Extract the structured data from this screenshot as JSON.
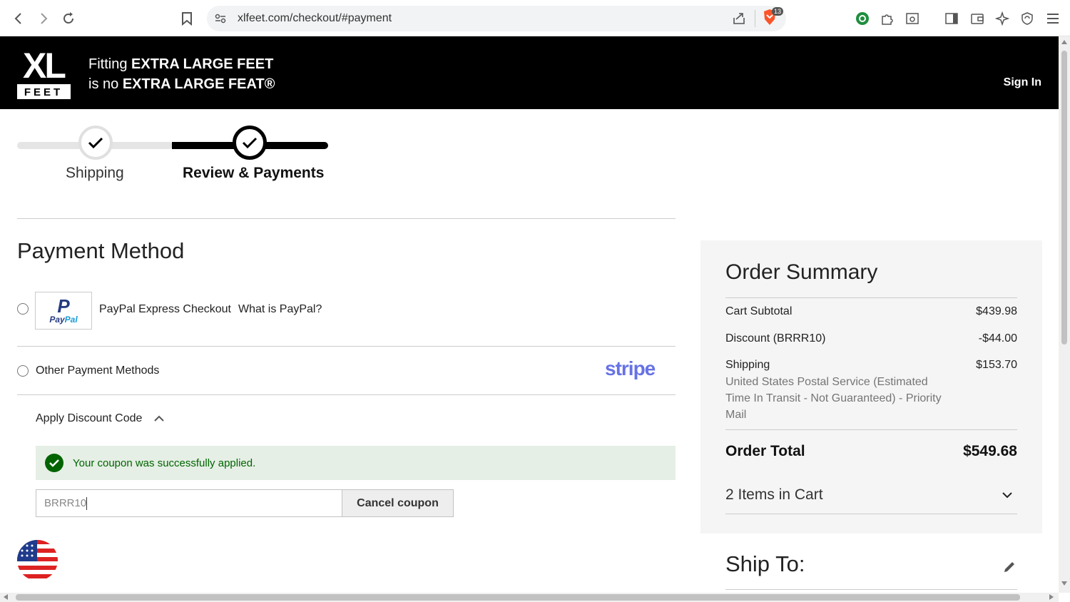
{
  "browser": {
    "url": "xlfeet.com/checkout/#payment",
    "shields_count": "13"
  },
  "header": {
    "logo_text_top": "XL",
    "logo_text_bottom": "FEET",
    "tagline_line1_prefix": "Fitting ",
    "tagline_line1_bold": "EXTRA LARGE FEET",
    "tagline_line2_prefix": "is no ",
    "tagline_line2_bold": "EXTRA LARGE FEAT®",
    "sign_in": "Sign In"
  },
  "progress": {
    "steps": [
      {
        "label": "Shipping",
        "state": "complete"
      },
      {
        "label": "Review & Payments",
        "state": "current"
      }
    ]
  },
  "payment": {
    "title": "Payment Method",
    "paypal_logo_word_1": "Pay",
    "paypal_logo_word_2": "Pal",
    "paypal_label": "PayPal Express Checkout",
    "paypal_what": "What is PayPal?",
    "other_label": "Other Payment Methods",
    "stripe_logo": "stripe"
  },
  "discount": {
    "toggle_label": "Apply Discount Code",
    "success_message": "Your coupon was successfully applied.",
    "code_value": "BRRR10",
    "cancel_label": "Cancel coupon"
  },
  "summary": {
    "title": "Order Summary",
    "subtotal_label": "Cart Subtotal",
    "subtotal_value": "$439.98",
    "discount_label": "Discount (BRRR10)",
    "discount_value": "-$44.00",
    "shipping_label": "Shipping",
    "shipping_value": "$153.70",
    "shipping_desc": "United States Postal Service (Estimated Time In Transit - Not Guaranteed) - Priority Mail",
    "total_label": "Order Total",
    "total_value": "$549.68",
    "items_label": "2 Items in Cart"
  },
  "ship_to": {
    "title": "Ship To:"
  },
  "colors": {
    "success_bg": "#e5efe5",
    "success_text": "#006400",
    "stripe": "#6772e5",
    "paypal_dark": "#253b80",
    "paypal_light": "#179bd7"
  }
}
